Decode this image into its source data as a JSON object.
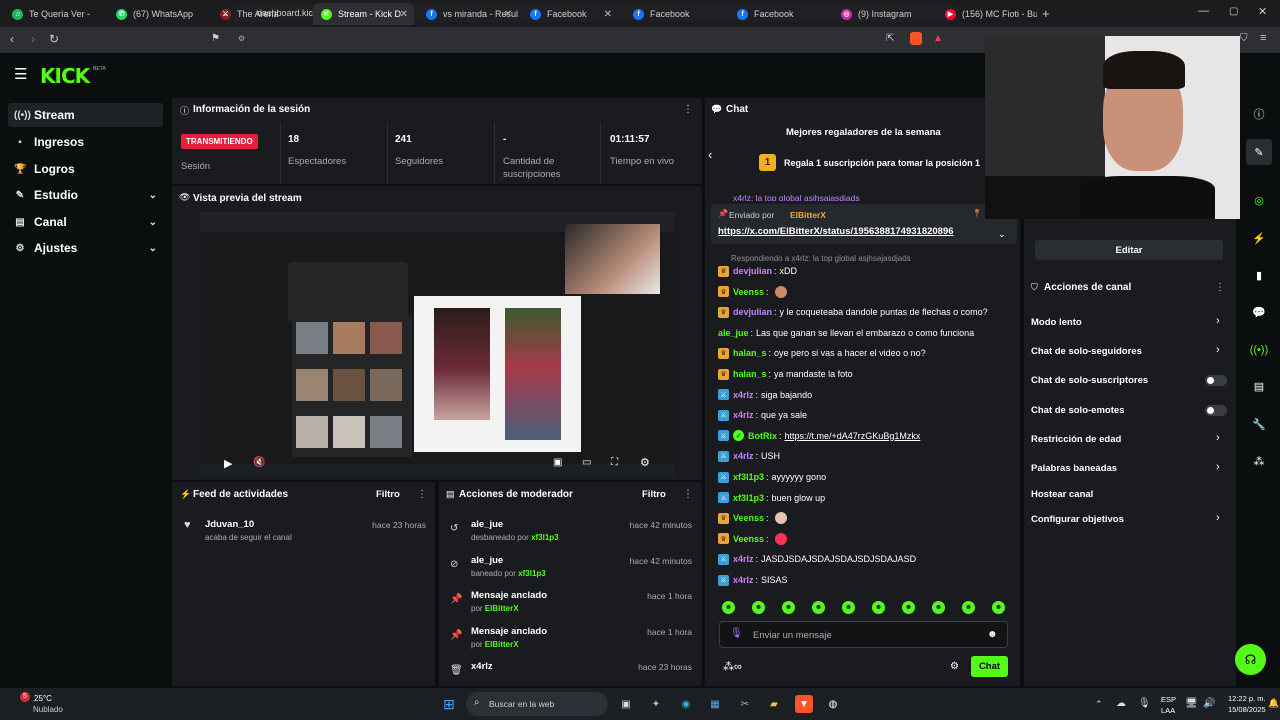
{
  "browser": {
    "tabs": [
      {
        "title": "Te Quería Ver - ",
        "color": "#1db954",
        "glyph": "♫"
      },
      {
        "title": "(67) WhatsApp",
        "color": "#25d366",
        "glyph": "✆"
      },
      {
        "title": "The Arena",
        "color": "#8b1e1e",
        "glyph": "⚔"
      },
      {
        "title": "Stream - Kick D",
        "color": "#53fc18",
        "glyph": "K"
      },
      {
        "title": "vs miranda - Resulta",
        "color": "#1877f2",
        "glyph": "f"
      },
      {
        "title": "Facebook",
        "color": "#1877f2",
        "glyph": "f"
      },
      {
        "title": "Facebook",
        "color": "#1877f2",
        "glyph": "f"
      },
      {
        "title": "Facebook",
        "color": "#1877f2",
        "glyph": "f"
      },
      {
        "title": "(9) Instagram",
        "color": "#d6249f",
        "glyph": "◎"
      },
      {
        "title": "(156) MC Fioti - Bum",
        "color": "#ff0033",
        "glyph": "▶"
      }
    ],
    "url": "dashboard.kick.com/stream"
  },
  "logo": {
    "text": "KICK",
    "beta": "BETA"
  },
  "sidebar": {
    "items": [
      {
        "label": "Stream",
        "icon": "((•))"
      },
      {
        "label": "Ingresos",
        "icon": "▪"
      },
      {
        "label": "Logros",
        "icon": "🏆"
      },
      {
        "label": "Estudio",
        "icon": "✎"
      },
      {
        "label": "Canal",
        "icon": "▤"
      },
      {
        "label": "Ajustes",
        "icon": "⚙"
      }
    ]
  },
  "session": {
    "title": "Información de la sesión",
    "status": "TRANSMITIENDO",
    "session_label": "Sesión",
    "stats": [
      {
        "value": "18",
        "label": "Espectadores"
      },
      {
        "value": "241",
        "label": "Seguidores"
      },
      {
        "value": "-",
        "label": "Cantidad de suscripciones"
      },
      {
        "value": "01:11:57",
        "label": "Tiempo en vivo"
      }
    ]
  },
  "preview": {
    "title": "Vista previa del stream"
  },
  "feed": {
    "title": "Feed de actividades",
    "filter": "Filtro",
    "items": [
      {
        "name": "Jduvan_10",
        "sub": "acaba de seguir el canal",
        "time": "hace 23 horas"
      }
    ]
  },
  "mod": {
    "title": "Acciones de moderador",
    "filter": "Filtro",
    "items": [
      {
        "icon": "↺",
        "name": "ale_jue",
        "pre": "desbaneado por",
        "by": "xf3l1p3",
        "time": "hace 42 minutos"
      },
      {
        "icon": "⊘",
        "name": "ale_jue",
        "pre": "baneado por",
        "by": "xf3l1p3",
        "time": "hace 42 minutos"
      },
      {
        "icon": "📌",
        "name": "Mensaje anclado",
        "pre": "por",
        "by": "ElBitterX",
        "time": "hace 1 hora"
      },
      {
        "icon": "📌",
        "name": "Mensaje anclado",
        "pre": "por",
        "by": "ElBitterX",
        "time": "hace 1 hora"
      },
      {
        "icon": "🗑",
        "name": "x4rlz",
        "pre": "",
        "by": "",
        "time": "hace 23 horas"
      }
    ]
  },
  "chat": {
    "title": "Chat",
    "gifters_title": "Mejores regaladores de la semana",
    "gifters_rank": "1",
    "gifters_text": "Regala 1 suscripción para tomar la posición 1",
    "partial": "x4rlz: la top global asjhsajasdjads",
    "pinned_by_label": "Enviado por",
    "pinned_user": "ElBitterX",
    "pinned_link": "https://x.com/ElBitterX/status/1956388174931820896",
    "reply_note": "Respondiendo a x4rlz: la top global asjhsajasdjads",
    "messages": [
      {
        "badge": "gold",
        "user": "devjulian",
        "color": "purple",
        "text": "xDD"
      },
      {
        "badge": "gold",
        "user": "Veenss",
        "color": "green",
        "text": "",
        "emote": "#c98a6b"
      },
      {
        "badge": "gold",
        "user": "devjulian",
        "color": "purple",
        "text": "y le coqueteaba dandole puntas de flechas o como?"
      },
      {
        "badge": "",
        "user": "ale_jue",
        "color": "green",
        "text": "Las que ganan se llevan el embarazo o como funciona"
      },
      {
        "badge": "gold",
        "user": "halan_s",
        "color": "green",
        "text": "oye pero si vas a hacer el video o no?"
      },
      {
        "badge": "gold",
        "user": "halan_s",
        "color": "green",
        "text": "ya mandaste la foto"
      },
      {
        "badge": "blue",
        "user": "x4rlz",
        "color": "purple",
        "text": "siga bajando"
      },
      {
        "badge": "blue",
        "user": "x4rlz",
        "color": "purple",
        "text": "que ya sale"
      },
      {
        "badge": "blue",
        "user": "BotRix",
        "color": "green",
        "text": "https://t.me/+dA47rzGKuBg1Mzkx",
        "link": true
      },
      {
        "badge": "blue",
        "user": "x4rlz",
        "color": "purple",
        "text": "USH"
      },
      {
        "badge": "blue",
        "user": "xf3l1p3",
        "color": "green",
        "text": "ayyyyyy gono"
      },
      {
        "badge": "blue",
        "user": "xf3l1p3",
        "color": "green",
        "text": "buen glow up"
      },
      {
        "badge": "gold",
        "user": "Veenss",
        "color": "green",
        "text": "",
        "emote": "#e8c2b0"
      },
      {
        "badge": "gold",
        "user": "Veenss",
        "color": "green",
        "text": "",
        "emote": "#ff3355"
      },
      {
        "badge": "blue",
        "user": "x4rlz",
        "color": "purple",
        "text": "JASDJSDAJSDAJSDAJSDJSDAJASD"
      },
      {
        "badge": "blue",
        "user": "x4rlz",
        "color": "purple",
        "text": "SISAS"
      }
    ],
    "input_placeholder": "Enviar un mensaje",
    "send_label": "Chat"
  },
  "right": {
    "edit_label": "Editar",
    "actions_title": "Acciones de canal",
    "actions": [
      {
        "label": "Modo lento",
        "type": "chevron"
      },
      {
        "label": "Chat de solo-seguidores",
        "type": "chevron"
      },
      {
        "label": "Chat de solo-suscriptores",
        "type": "toggle"
      },
      {
        "label": "Chat de solo-emotes",
        "type": "toggle"
      },
      {
        "label": "Restricción de edad",
        "type": "chevron"
      },
      {
        "label": "Palabras baneadas",
        "type": "chevron"
      },
      {
        "label": "Hostear canal",
        "type": "none"
      },
      {
        "label": "Configurar objetivos",
        "type": "chevron"
      }
    ]
  },
  "taskbar": {
    "weather_temp": "25°C",
    "weather_desc": "Nublado",
    "weather_alert": "5",
    "search_placeholder": "Buscar en la web",
    "lang1": "ESP",
    "lang2": "LAA",
    "time": "12:22 p. m.",
    "date": "15/08/2025"
  }
}
